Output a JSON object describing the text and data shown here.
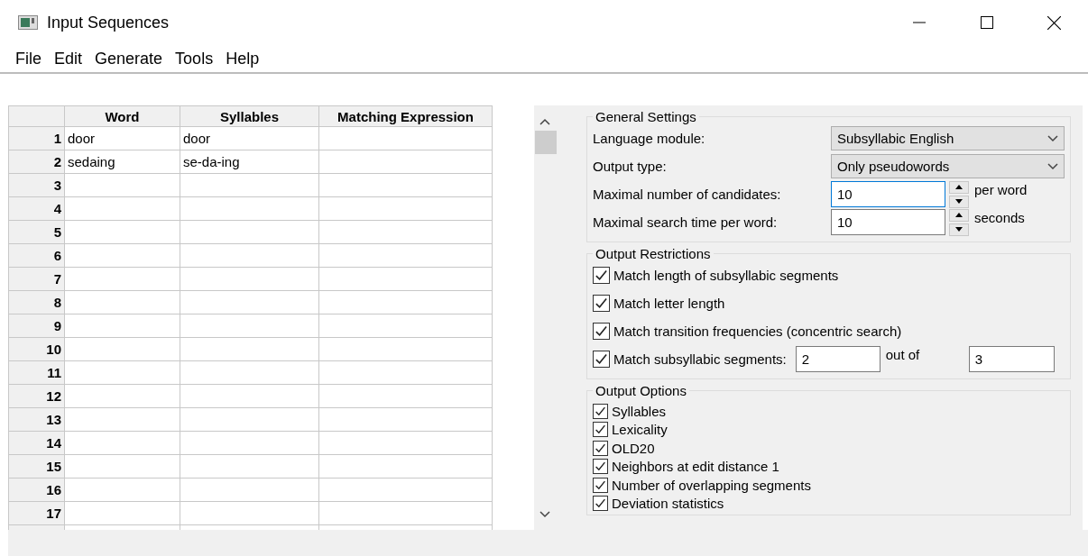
{
  "window": {
    "title": "Input Sequences"
  },
  "menu": [
    "File",
    "Edit",
    "Generate",
    "Tools",
    "Help"
  ],
  "table": {
    "columns": [
      "Word",
      "Syllables",
      "Matching Expression"
    ],
    "rows": [
      {
        "number": "1",
        "cells": [
          "door",
          "door"
        ]
      },
      {
        "number": "2",
        "cells": [
          "sedaing",
          "se-da-ing"
        ]
      },
      {
        "number": "3",
        "cells": []
      },
      {
        "number": "4",
        "cells": []
      },
      {
        "number": "5",
        "cells": []
      },
      {
        "number": "6",
        "cells": []
      },
      {
        "number": "7",
        "cells": []
      },
      {
        "number": "8",
        "cells": []
      },
      {
        "number": "9",
        "cells": []
      },
      {
        "number": "10",
        "cells": []
      },
      {
        "number": "11",
        "cells": []
      },
      {
        "number": "12",
        "cells": []
      },
      {
        "number": "13",
        "cells": []
      },
      {
        "number": "14",
        "cells": []
      },
      {
        "number": "15",
        "cells": []
      },
      {
        "number": "16",
        "cells": []
      },
      {
        "number": "17",
        "cells": []
      }
    ]
  },
  "general_settings": {
    "title": "General Settings",
    "fields": [
      {
        "kind": "dropdown",
        "label": "Language module:",
        "value": "Subsyllabic English"
      },
      {
        "kind": "dropdown",
        "label": "Output type:",
        "value": "Only pseudowords"
      },
      {
        "kind": "spin",
        "label": "Maximal number of candidates:",
        "value": "10",
        "unit": "per word",
        "focused": true
      },
      {
        "kind": "spin",
        "label": "Maximal search time per word:",
        "value": "10",
        "unit": "seconds",
        "focused": false
      }
    ]
  },
  "output_restrictions": {
    "title": "Output Restrictions",
    "items": [
      {
        "kind": "checkbox",
        "label": "Match length of subsyllabic segments",
        "checked": true
      },
      {
        "kind": "checkbox",
        "label": "Match letter length",
        "checked": true
      },
      {
        "kind": "checkbox",
        "label": "Match transition frequencies (concentric search)",
        "checked": true
      },
      {
        "kind": "range",
        "label": "Match subsyllabic segments:",
        "checked": true,
        "value": "2",
        "separator": "out of",
        "total": "3"
      }
    ]
  },
  "output_options": {
    "title": "Output Options",
    "items": [
      {
        "label": "Syllables",
        "checked": true
      },
      {
        "label": "Lexicality",
        "checked": true
      },
      {
        "label": "OLD20",
        "checked": true
      },
      {
        "label": "Neighbors at edit distance 1",
        "checked": true
      },
      {
        "label": "Number of overlapping segments",
        "checked": true
      },
      {
        "label": "Deviation statistics",
        "checked": true
      }
    ]
  }
}
